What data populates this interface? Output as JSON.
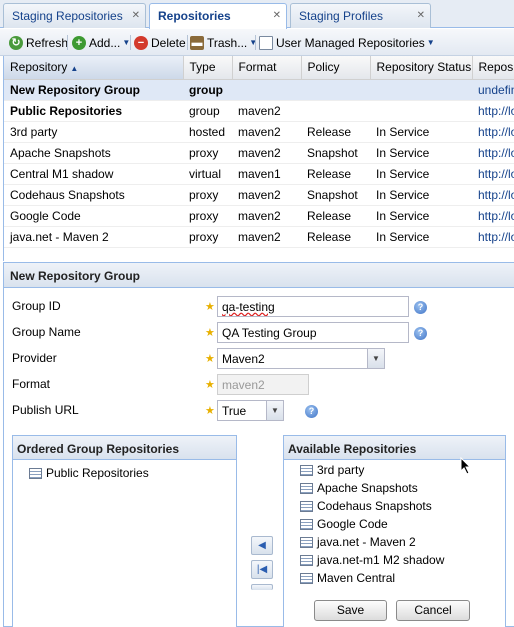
{
  "tabs": [
    {
      "label": "Staging Repositories",
      "active": false
    },
    {
      "label": "Repositories",
      "active": true
    },
    {
      "label": "Staging Profiles",
      "active": false
    }
  ],
  "tab_close": "✕",
  "toolbar": {
    "refresh": "Refresh",
    "add": "Add...",
    "delete": "Delete",
    "trash": "Trash...",
    "user_managed": "User Managed Repositories"
  },
  "grid": {
    "columns": [
      "Repository",
      "Type",
      "Format",
      "Policy",
      "Repository Status",
      "Repository Path"
    ],
    "rows": [
      {
        "name": "New Repository Group",
        "type": "group",
        "format": "",
        "policy": "",
        "status": "",
        "path": "undefined"
      },
      {
        "name": "Public Repositories",
        "type": "group",
        "format": "maven2",
        "policy": "",
        "status": "",
        "path": "http://localhost"
      },
      {
        "name": "3rd party",
        "type": "hosted",
        "format": "maven2",
        "policy": "Release",
        "status": "In Service",
        "path": "http://localhost"
      },
      {
        "name": "Apache Snapshots",
        "type": "proxy",
        "format": "maven2",
        "policy": "Snapshot",
        "status": "In Service",
        "path": "http://localhost"
      },
      {
        "name": "Central M1 shadow",
        "type": "virtual",
        "format": "maven1",
        "policy": "Release",
        "status": "In Service",
        "path": "http://localhost"
      },
      {
        "name": "Codehaus Snapshots",
        "type": "proxy",
        "format": "maven2",
        "policy": "Snapshot",
        "status": "In Service",
        "path": "http://localhost"
      },
      {
        "name": "Google Code",
        "type": "proxy",
        "format": "maven2",
        "policy": "Release",
        "status": "In Service",
        "path": "http://localhost"
      },
      {
        "name": "java.net - Maven 2",
        "type": "proxy",
        "format": "maven2",
        "policy": "Release",
        "status": "In Service",
        "path": "http://localhost"
      }
    ]
  },
  "form": {
    "title": "New Repository Group",
    "group_id_label": "Group ID",
    "group_id_value": "qa-testing",
    "group_name_label": "Group Name",
    "group_name_value": "QA Testing Group",
    "provider_label": "Provider",
    "provider_value": "Maven2",
    "format_label": "Format",
    "format_value": "maven2",
    "publish_label": "Publish URL",
    "publish_value": "True",
    "required_mark": "★",
    "help_mark": "?"
  },
  "ordered": {
    "title": "Ordered Group Repositories",
    "items": [
      "Public Repositories"
    ]
  },
  "available": {
    "title": "Available Repositories",
    "items": [
      "3rd party",
      "Apache Snapshots",
      "Codehaus Snapshots",
      "Google Code",
      "java.net - Maven 2",
      "java.net-m1 M2 shadow",
      "Maven Central"
    ]
  },
  "buttons": {
    "save": "Save",
    "cancel": "Cancel"
  }
}
